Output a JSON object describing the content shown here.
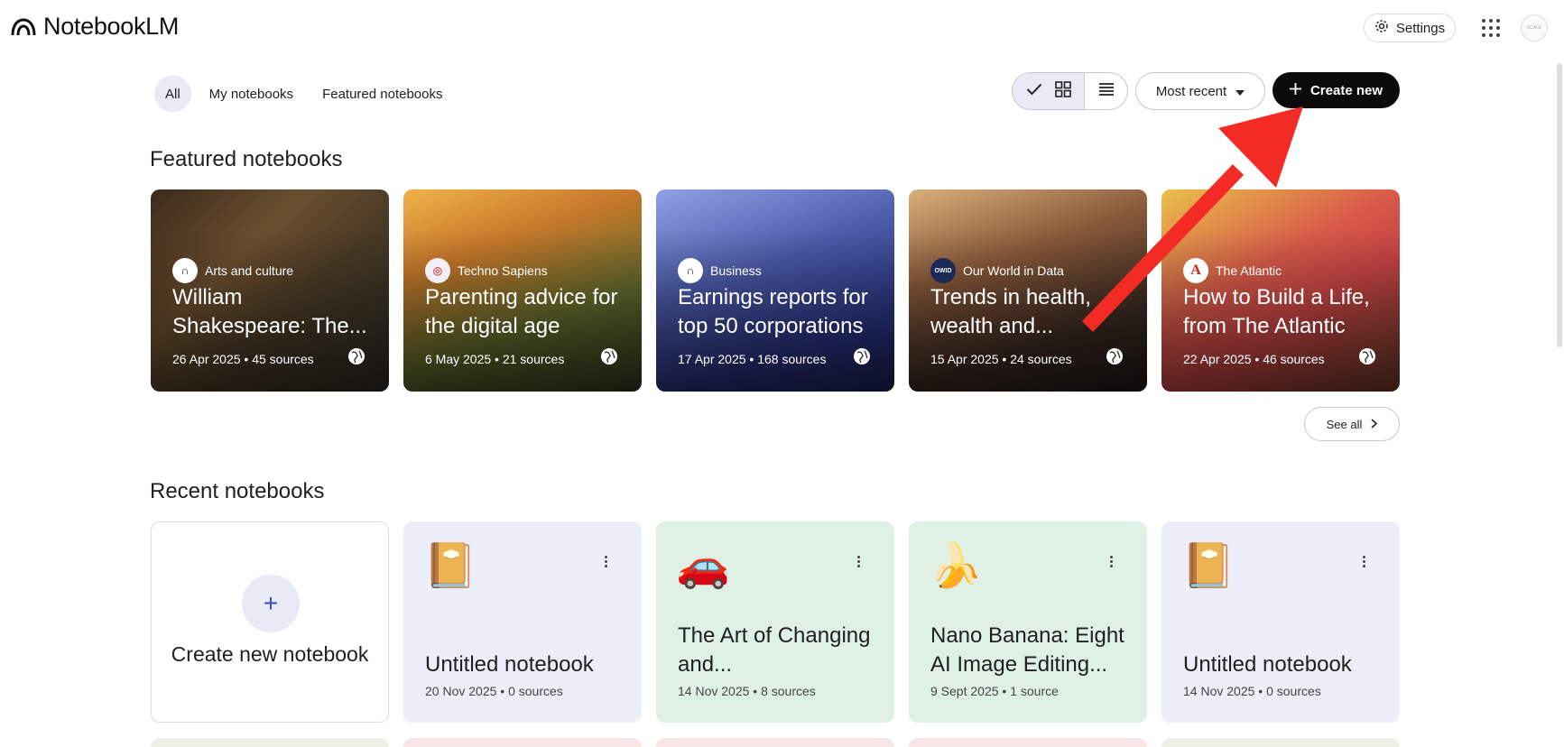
{
  "app": {
    "name": "NotebookLM"
  },
  "header": {
    "settings_label": "Settings",
    "apps_icon": "apps-grid-icon",
    "avatar_text": "SCALE"
  },
  "filters": {
    "tabs": [
      {
        "label": "All",
        "active": true
      },
      {
        "label": "My notebooks"
      },
      {
        "label": "Featured notebooks"
      }
    ]
  },
  "toolbar": {
    "sort_label": "Most recent",
    "create_label": "Create new"
  },
  "featured": {
    "title": "Featured notebooks",
    "see_all_label": "See all",
    "cards": [
      {
        "source": "Arts and culture",
        "title": "William Shakespeare: The...",
        "meta": "26 Apr 2025 • 45 sources"
      },
      {
        "source": "Techno Sapiens",
        "title": "Parenting advice for the digital age",
        "meta": "6 May 2025 • 21 sources"
      },
      {
        "source": "Business",
        "title": "Earnings reports for top 50 corporations",
        "meta": "17 Apr 2025 • 168 sources"
      },
      {
        "source": "Our World in Data",
        "title": "Trends in health, wealth and...",
        "meta": "15 Apr 2025 • 24 sources"
      },
      {
        "source": "The Atlantic",
        "title": "How to Build a Life, from The Atlantic",
        "meta": "22 Apr 2025 • 46 sources"
      }
    ]
  },
  "recent": {
    "title": "Recent notebooks",
    "create_card_label": "Create new notebook",
    "cards": [
      {
        "emoji": "📔",
        "title": "Untitled notebook",
        "meta": "20 Nov 2025 • 0 sources"
      },
      {
        "emoji": "🚗",
        "title": "The Art of Changing and...",
        "meta": "14 Nov 2025 • 8 sources"
      },
      {
        "emoji": "🍌",
        "title": "Nano Banana: Eight AI Image Editing...",
        "meta": "9 Sept 2025 • 1 source"
      },
      {
        "emoji": "📔",
        "title": "Untitled notebook",
        "meta": "14 Nov 2025 • 0 sources"
      }
    ]
  },
  "colors": {
    "accent": "#e8eaf6",
    "create_button": "#0b0b0b",
    "annotation_arrow": "#f42a24",
    "card_lavender": "#eceefa",
    "card_mint": "#dff0e4"
  }
}
